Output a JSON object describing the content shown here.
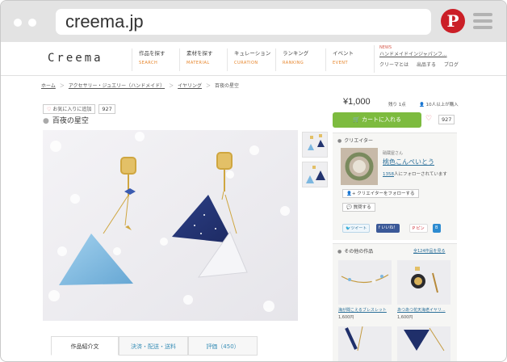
{
  "browser": {
    "url": "creema.jp"
  },
  "header": {
    "logo": "Creema",
    "nav": [
      {
        "jp": "作品を探す",
        "en": "SEARCH"
      },
      {
        "jp": "素材を探す",
        "en": "MATERIAL"
      },
      {
        "jp": "キュレーション",
        "en": "CURATION"
      },
      {
        "jp": "ランキング",
        "en": "RANKING"
      },
      {
        "jp": "イベント",
        "en": "EVENT"
      }
    ],
    "news": {
      "tag": "NEWS",
      "headline": "ハンドメイドインジャパンフ...",
      "links": [
        "クリーマとは",
        "出品する",
        "ブログ"
      ]
    }
  },
  "breadcrumb": [
    "ホーム",
    "アクセサリー・ジュエリー（ハンドメイド）",
    "イヤリング",
    "百夜の星空"
  ],
  "product": {
    "favorite_label": "お気に入りに追加",
    "favorite_count": "927",
    "title": "百夜の星空",
    "tabs": [
      "作品紹介文",
      "決済・配送・送料",
      "評価（450）"
    ]
  },
  "purchase": {
    "price": "¥1,000",
    "stock": "残り 1点",
    "buyers": "10人以上が購入",
    "cart_label": "カートに入れる",
    "fav_count": "927"
  },
  "creator": {
    "heading": "クリエイター",
    "subtitle": "硝蔵屋さん",
    "name": "桃色こんぺいとう",
    "followers": "1358",
    "followers_text": "人にフォローされています",
    "follow_label": "クリエイターをフォローする",
    "ask_label": "質問する"
  },
  "share": {
    "tweet": "ツイート",
    "like": "いいね！",
    "pin": "ピン"
  },
  "other_works": {
    "heading": "その他の作品",
    "all_link": "全124作品を見る",
    "items": [
      {
        "name": "海が聞こえるブレスレット",
        "price": "1,600円"
      },
      {
        "name": "あつあつ花天海老イヤリ...",
        "price": "1,600円"
      }
    ]
  },
  "colors": {
    "accent": "#7dbb3f",
    "link": "#2a6f99",
    "nav_en": "#e6842a",
    "pinterest": "#cb1f27"
  }
}
